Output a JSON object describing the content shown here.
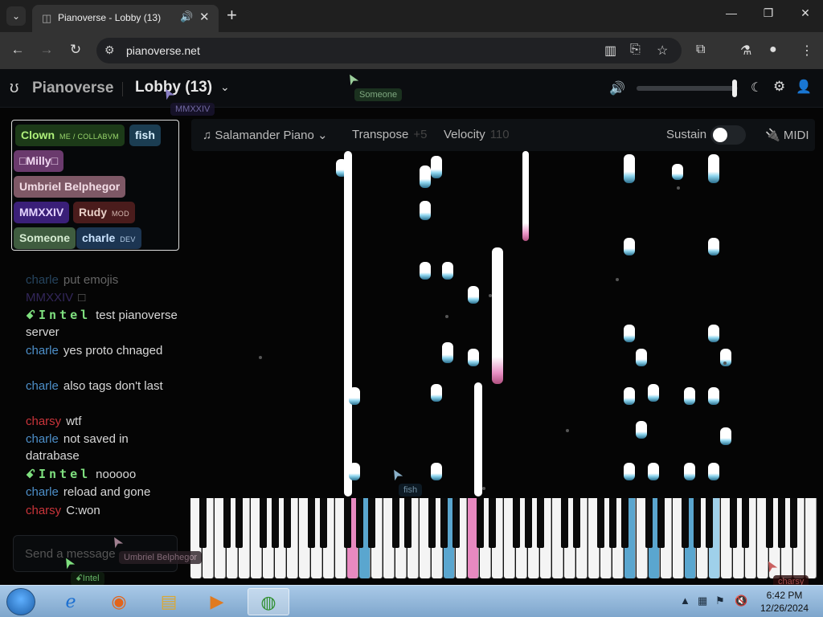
{
  "browser": {
    "tab_title": "Pianoverse - Lobby (13)",
    "url": "pianoverse.net",
    "window_controls": [
      "minimize-icon",
      "restore-icon",
      "close-icon"
    ],
    "toolbar_icons": [
      "reading-mode-icon",
      "install-app-icon",
      "bookmark-star-icon",
      "extensions-icon",
      "labs-icon",
      "profile-icon",
      "menu-icon"
    ]
  },
  "app": {
    "brand": "Pianoverse",
    "room": "Lobby (13)",
    "volume": 0.97,
    "users": [
      {
        "name": "Clown",
        "tag": "ME / COLLABVM",
        "color": "#aef07a",
        "bg": "#1c3a18"
      },
      {
        "name": "fish",
        "tag": "",
        "color": "#d7f0ff",
        "bg": "#1b3d52"
      },
      {
        "name": "□Milly□",
        "tag": "",
        "color": "#f2d9f2",
        "bg": "#6a3a6d"
      },
      {
        "name": "Umbriel Belphegor",
        "tag": "",
        "color": "#f3dde6",
        "bg": "#7e5866"
      },
      {
        "name": "MMXXIV",
        "tag": "",
        "color": "#e4d4ff",
        "bg": "#3a1f78"
      },
      {
        "name": "Rudy",
        "tag": "MOD",
        "color": "#e9d0c8",
        "bg": "#4a1c1c"
      },
      {
        "name": "Someone",
        "tag": "",
        "color": "#d6ecd2",
        "bg": "#3f5c3f"
      },
      {
        "name": "charle",
        "tag": "DEV",
        "color": "#cbe4ff",
        "bg": "#1c3552"
      }
    ],
    "chat": [
      {
        "nick": "charle",
        "text": "put emojis",
        "nick_color": "#4d8fc9"
      },
      {
        "nick": "MMXXIV",
        "text": "□",
        "nick_color": "#6a4fc0"
      },
      {
        "nick": "ꗃIntel",
        "text": "test pianoverse server",
        "nick_color": "#7fe07f"
      },
      {
        "nick": "charle",
        "text": "yes proto chnaged",
        "nick_color": "#4d8fc9"
      },
      {
        "nick": "charle",
        "text": "also tags don't last",
        "nick_color": "#4d8fc9"
      },
      {
        "nick": "charsy",
        "text": "wtf",
        "nick_color": "#c9343a"
      },
      {
        "nick": "charle",
        "text": "not saved in datrabase",
        "nick_color": "#4d8fc9"
      },
      {
        "nick": "ꗃIntel",
        "text": "nooooo",
        "nick_color": "#7fe07f"
      },
      {
        "nick": "charle",
        "text": "reload and gone",
        "nick_color": "#4d8fc9"
      },
      {
        "nick": "charsy",
        "text": "C:won",
        "nick_color": "#c9343a"
      }
    ],
    "chat_placeholder": "Send a message",
    "controls": {
      "instrument": "Salamander Piano",
      "transpose_label": "Transpose",
      "transpose_value": "+5",
      "velocity_label": "Velocity",
      "velocity_value": "110",
      "sustain_label": "Sustain",
      "sustain_on": false,
      "midi_label": "MIDI"
    },
    "cursors": [
      {
        "name": "MMXXIV",
        "color": "#8a7fc6",
        "bg": "#1a1530"
      },
      {
        "name": "Someone",
        "color": "#9ccf9c",
        "bg": "#1f3a23"
      },
      {
        "name": "fish",
        "color": "#8ab0c8",
        "bg": "#10202c"
      },
      {
        "name": "Umbriel Belphegor",
        "color": "#a08090",
        "bg": "#2a1f25"
      },
      {
        "name": "ꗃIntel",
        "color": "#7fe07f",
        "bg": "#102010"
      },
      {
        "name": "charsy",
        "color": "#c96060",
        "bg": "#2a0a0a"
      }
    ]
  },
  "taskbar": {
    "time": "6:42 PM",
    "date": "12/26/2024"
  }
}
